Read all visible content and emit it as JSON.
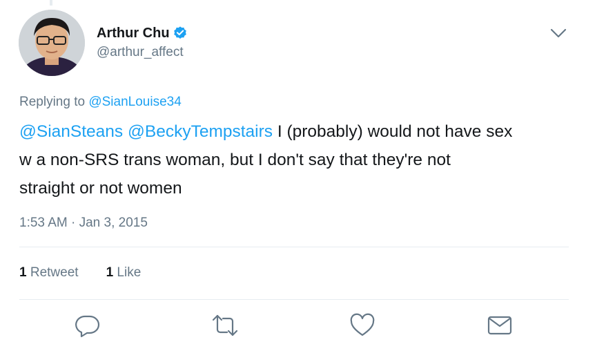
{
  "tweet": {
    "author": {
      "display_name": "Arthur Chu",
      "handle": "@arthur_affect",
      "verified": true
    },
    "replying_prefix": "Replying to ",
    "replying_to": "@SianLouise34",
    "mention_1": "@SianSteans",
    "mention_2": "@BeckyTempstairs",
    "body_line_1": " I (probably) would not have sex",
    "body_line_2": "w a non-SRS trans woman, but I don't say that they're not",
    "body_line_3": "straight or not women",
    "timestamp": "1:53 AM · Jan 3, 2015",
    "stats": {
      "retweets_count": "1",
      "retweets_label": "Retweet",
      "likes_count": "1",
      "likes_label": "Like"
    },
    "actions": [
      "reply-icon",
      "retweet-icon",
      "like-icon",
      "message-icon"
    ]
  },
  "colors": {
    "accent": "#1da1f2",
    "text": "#14171a",
    "muted": "#657786",
    "divider": "#e6ecf0"
  }
}
